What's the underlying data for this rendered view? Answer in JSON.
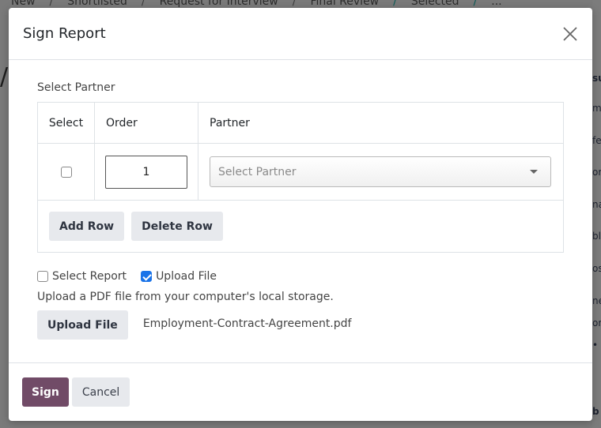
{
  "background": {
    "breadcrumb": [
      "New",
      "Shortlisted",
      "Request for Interview",
      "Final Review",
      "Selected",
      "..."
    ],
    "right_strip_fragments": [
      "su",
      "m",
      "fe",
      "or",
      "na",
      "bl",
      "os",
      "ne",
      "or",
      "•",
      "b"
    ]
  },
  "modal": {
    "title": "Sign Report",
    "close_icon": "close-icon",
    "select_partner_label": "Select Partner",
    "table": {
      "headers": [
        "Select",
        "Order",
        "Partner"
      ],
      "rows": [
        {
          "selected": false,
          "order": "1",
          "partner_placeholder": "Select Partner"
        }
      ]
    },
    "add_row_label": "Add Row",
    "delete_row_label": "Delete Row",
    "options": {
      "select_report": {
        "label": "Select Report",
        "checked": false
      },
      "upload_file": {
        "label": "Upload File",
        "checked": true
      }
    },
    "upload_help": "Upload a PDF file from your computer's local storage.",
    "upload_button_label": "Upload File",
    "uploaded_file_name": "Employment-Contract-Agreement.pdf",
    "footer": {
      "sign_label": "Sign",
      "cancel_label": "Cancel"
    }
  },
  "colors": {
    "primary": "#714b67",
    "secondary_button": "#e7e9ed",
    "checkbox_checked": "#1a73e8",
    "overlay": "#7a7a7a"
  }
}
